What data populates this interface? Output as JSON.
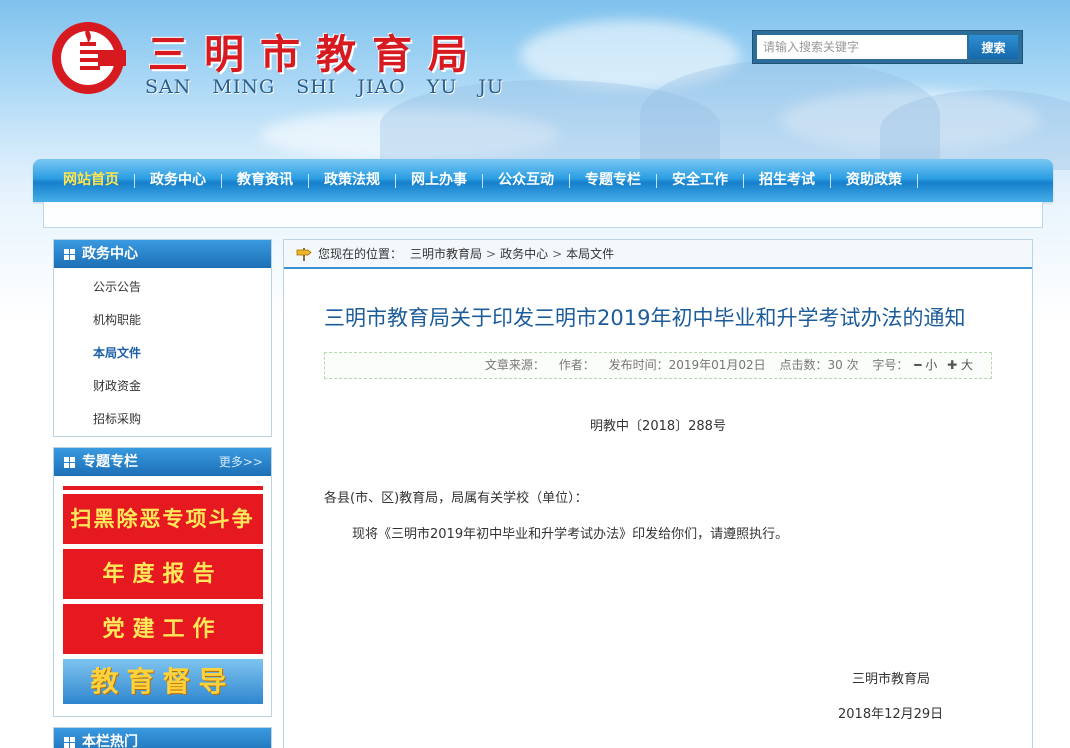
{
  "header": {
    "title": "三明市教育局",
    "subtitle": "SAN MING SHI JIAO YU JU",
    "search": {
      "placeholder": "请输入搜索关键字",
      "button": "搜索"
    }
  },
  "nav": {
    "items": [
      "网站首页",
      "政务中心",
      "教育资讯",
      "政策法规",
      "网上办事",
      "公众互动",
      "专题专栏",
      "安全工作",
      "招生考试",
      "资助政策"
    ],
    "active_color": "#ffe44d"
  },
  "sidebar": {
    "gov_center": {
      "title": "政务中心",
      "items": [
        "公示公告",
        "机构职能",
        "本局文件",
        "财政资金",
        "招标采购"
      ],
      "active": "本局文件"
    },
    "special": {
      "title": "专题专栏",
      "more": "更多>>",
      "banners": [
        "扫黑除恶专项斗争",
        "年度报告",
        "党建工作",
        "教育督导"
      ]
    },
    "hot": {
      "title": "本栏热门"
    }
  },
  "breadcrumb": {
    "prefix": "您现在的位置：",
    "items": [
      "三明市教育局",
      "政务中心",
      "本局文件"
    ]
  },
  "article": {
    "title": "三明市教育局关于印发三明市2019年初中毕业和升学考试办法的通知",
    "meta": {
      "source": "文章来源：",
      "author": "作者：",
      "date": "发布时间：2019年01月02日",
      "views": "点击数：30 次",
      "font_label": "字号：",
      "font_small": "━ 小",
      "font_large": "✚ 大"
    },
    "doc_no": "明教中〔2018〕288号",
    "salutation": "各县(市、区)教育局，局属有关学校（单位）：",
    "body": "现将《三明市2019年初中毕业和升学考试办法》印发给你们，请遵照执行。",
    "sign_org": "三明市教育局",
    "sign_date": "2018年12月29日"
  },
  "colors": {
    "brand_red": "#d71920",
    "nav_blue": "#1680cc",
    "title_blue": "#1d5c9a"
  }
}
